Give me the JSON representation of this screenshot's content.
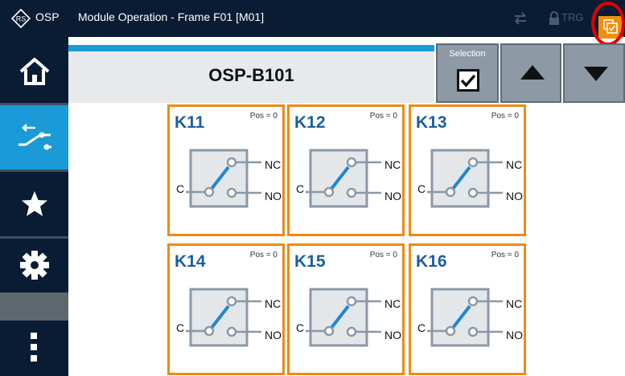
{
  "titlebar": {
    "app_name": "OSP",
    "window_title": "Module Operation - Frame F01 [M01]",
    "trigger_label": "TRG",
    "icons": [
      "rs-logo-icon",
      "trigger-arrows-icon",
      "lock-icon",
      "copy-checkbox-icon"
    ]
  },
  "sidebar": {
    "items": [
      {
        "name": "home",
        "icon": "home-icon",
        "active": false
      },
      {
        "name": "switch",
        "icon": "switch-icon",
        "active": true
      },
      {
        "name": "favorites",
        "icon": "star-icon",
        "active": false
      },
      {
        "name": "settings",
        "icon": "gear-icon",
        "active": false
      },
      {
        "name": "more",
        "icon": "more-vertical-icon",
        "active": false
      }
    ]
  },
  "header": {
    "module_name": "OSP-B101",
    "selection_label": "Selection",
    "selection_checked": true
  },
  "relays": [
    {
      "name": "K11",
      "pos": "Pos = 0",
      "c": "C",
      "nc": "NC",
      "no": "NO"
    },
    {
      "name": "K12",
      "pos": "Pos = 0",
      "c": "C",
      "nc": "NC",
      "no": "NO"
    },
    {
      "name": "K13",
      "pos": "Pos = 0",
      "c": "C",
      "nc": "NC",
      "no": "NO"
    },
    {
      "name": "K14",
      "pos": "Pos = 0",
      "c": "C",
      "nc": "NC",
      "no": "NO"
    },
    {
      "name": "K15",
      "pos": "Pos = 0",
      "c": "C",
      "nc": "NC",
      "no": "NO"
    },
    {
      "name": "K16",
      "pos": "Pos = 0",
      "c": "C",
      "nc": "NC",
      "no": "NO"
    }
  ],
  "colors": {
    "titlebar_bg": "#0a1c34",
    "accent_blue": "#1a9ad6",
    "relay_border": "#ef8a12",
    "relay_title": "#1d5ea0",
    "toolbar_button": "#8d99a4",
    "highlight_ring": "#e00000"
  }
}
